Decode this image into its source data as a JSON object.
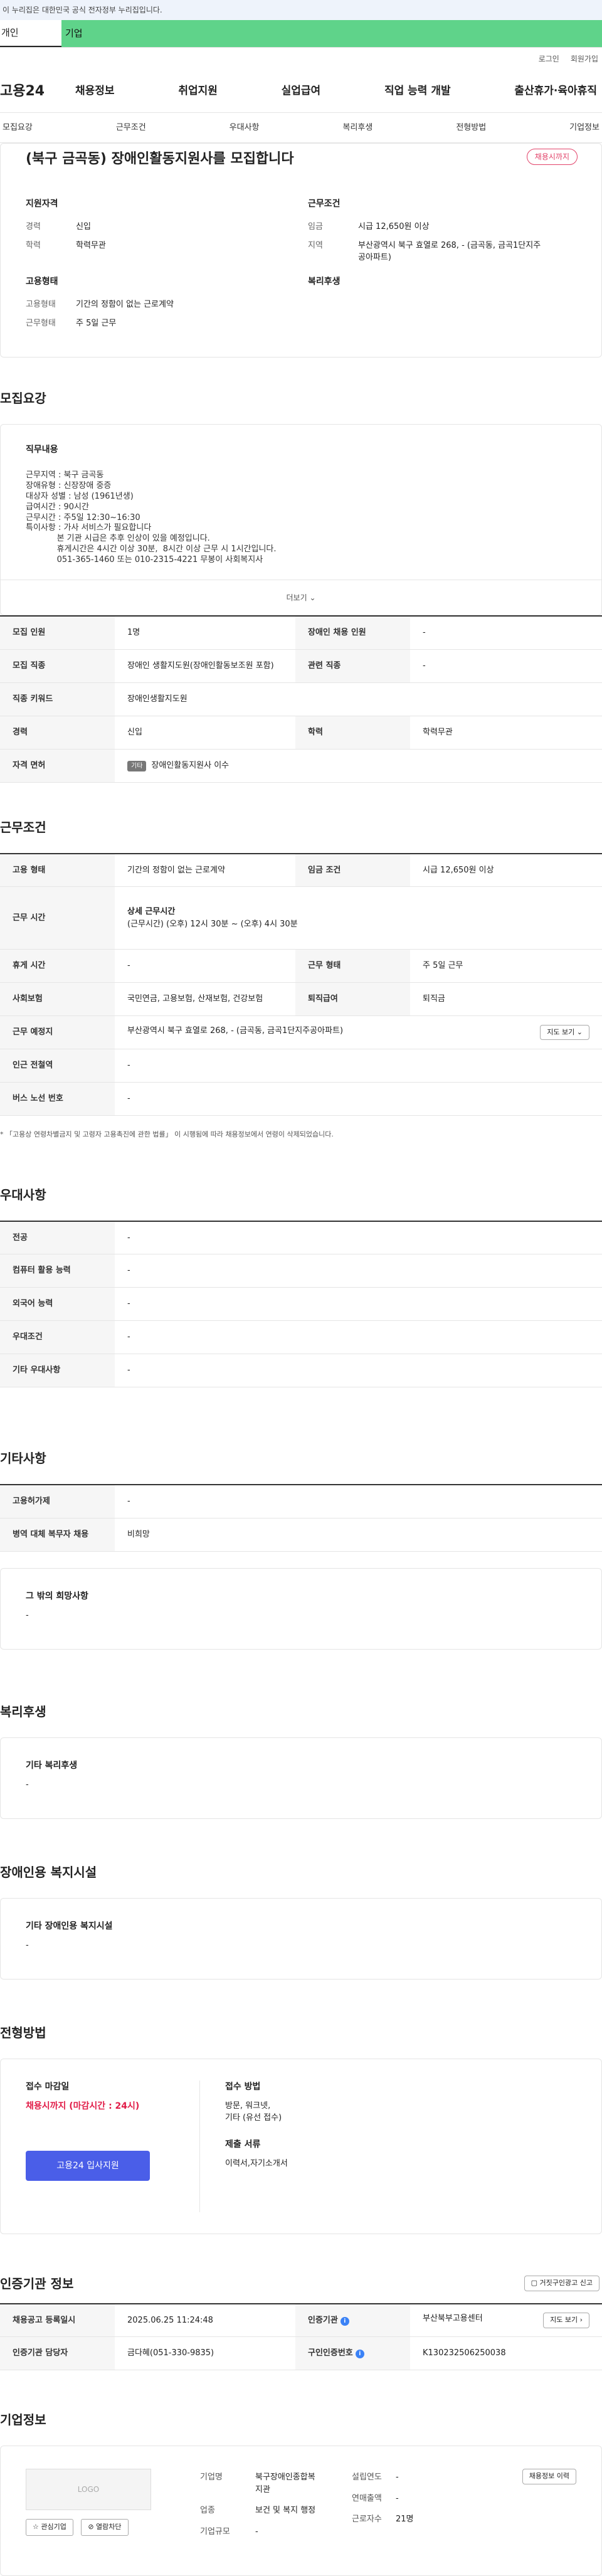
{
  "gov_notice": "이 누리집은 대한민국 공식 전자정부 누리집입니다.",
  "tabs": {
    "personal": "개인",
    "company": "기업"
  },
  "toplinks": [
    "로그인",
    "회원가입"
  ],
  "logo": "고용24",
  "gnb": [
    "채용정보",
    "취업지원",
    "실업급여",
    "직업 능력 개발",
    "출산휴가·육아휴직"
  ],
  "anchors": [
    "모집요강",
    "근무조건",
    "우대사항",
    "복리후생",
    "전형방법",
    "기업정보"
  ],
  "summary": {
    "title": "(북구 금곡동) 장애인활동지원사를 모집합니다",
    "badge": "채용시까지",
    "qual_head": "지원자격",
    "career_k": "경력",
    "career_v": "신입",
    "edu_k": "학력",
    "edu_v": "학력무관",
    "cond_head": "근무조건",
    "wage_k": "임금",
    "wage_v": "시급 12,650원 이상",
    "loc_k": "지역",
    "loc_v": "부산광역시 북구 효열로 268, - (금곡동, 금곡1단지주공아파트)",
    "emp_head": "고용형태",
    "emp_k": "고용형태",
    "emp_v": "기간의 정함이 없는 근로계약",
    "work_k": "근무형태",
    "work_v": "주 5일 근무",
    "welfare_head": "복리후생"
  },
  "recruit": {
    "title": "모집요강",
    "duty_head": "직무내용",
    "lines": [
      "근무지역 : 북구 금곡동",
      "장애유형 : 신장장애 중증",
      "대상자 성별 : 남성 (1961년생)",
      "급여시간 : 90시간",
      "근무시간 : 주5일 12:30~16:30",
      "특이사항 : 가사 서비스가 필요합니다",
      "            본 기관 시급은 추후 인상이 있을 예정입니다.",
      "            휴게시간은 4시간 이상 30분,  8시간 이상 근무 시 1시간입니다.",
      "            051-365-1460 또는 010-2315-4221 무봉이 사회복지사"
    ],
    "more": "더보기",
    "rows": {
      "count_k": "모집 인원",
      "count_v": "1명",
      "dis_k": "장애인 채용 인원",
      "dis_v": "-",
      "job_k": "모집 직종",
      "job_v": "장애인 생활지도원(장애인활동보조원 포함)",
      "rel_k": "관련 직종",
      "rel_v": "-",
      "kw_k": "직종 키워드",
      "kw_v": "장애인생활지도원",
      "car_k": "경력",
      "car_v": "신입",
      "edu_k": "학력",
      "edu_v": "학력무관",
      "lic_k": "자격 면허",
      "lic_chip": "기타",
      "lic_v": "장애인활동지원사 이수"
    }
  },
  "work": {
    "title": "근무조건",
    "type_k": "고용 형태",
    "type_v": "기간의 정함이 없는 근로계약",
    "wage_k": "임금 조건",
    "wage_v": "시급 12,650원 이상",
    "time_k": "근무 시간",
    "time_head": "상세 근무시간",
    "time_v": "(근무시간) (오후) 12시 30분 ~ (오후) 4시 30분",
    "rest_k": "휴게 시간",
    "rest_v": "-",
    "form_k": "근무 형태",
    "form_v": "주 5일 근무",
    "ins_k": "사회보험",
    "ins_v": "국민연금, 고용보험, 산재보험, 건강보험",
    "sev_k": "퇴직급여",
    "sev_v": "퇴직금",
    "place_k": "근무 예정지",
    "place_v": "부산광역시 북구 효열로 268, - (금곡동, 금곡1단지주공아파트)",
    "map_btn": "지도 보기",
    "sub_k": "인근 전철역",
    "sub_v": "-",
    "bus_k": "버스 노선 번호",
    "bus_v": "-",
    "note": "* 「고용상 연령차별금지 및 고령자 고용촉진에 관한 법률」 이 시행됨에 따라 채용정보에서 연령이 삭제되었습니다."
  },
  "pref": {
    "title": "우대사항",
    "rows": [
      [
        "전공",
        "-"
      ],
      [
        "컴퓨터 활용 능력",
        "-"
      ],
      [
        "외국어 능력",
        "-"
      ],
      [
        "우대조건",
        "-"
      ],
      [
        "기타 우대사항",
        "-"
      ]
    ]
  },
  "etc": {
    "title": "기타사항",
    "rows": [
      [
        "고용허가제",
        "-"
      ],
      [
        "병역 대체 복무자 채용",
        "비희망"
      ]
    ],
    "hope_head": "그 밖의 희망사항",
    "hope_v": "-"
  },
  "welfare": {
    "title": "복리후생",
    "head": "기타 복리후생",
    "v": "-"
  },
  "disabled": {
    "title": "장애인용 복지시설",
    "head": "기타 장애인용 복지시설",
    "v": "-"
  },
  "process": {
    "title": "전형방법",
    "deadline_head": "접수 마감일",
    "deadline_v": "채용시까지 (마감시간 : 24시)",
    "apply_btn": "고용24 입사지원",
    "method_head": "접수 방법",
    "method_v1": "방문, 워크넷,",
    "method_v2": "기타 (유선 접수)",
    "docs_head": "제출 서류",
    "docs_v": "이력서,자기소개서"
  },
  "agency": {
    "title": "인증기관 정보",
    "report_btn": "거짓구인광고 신고",
    "reg_k": "채용공고 등록일시",
    "reg_v": "2025.06.25 11:24:48",
    "ag_k": "인증기관",
    "ag_v": "부산북부고용센터",
    "map_btn": "지도 보기",
    "mgr_k": "인증기관 담당자",
    "mgr_v": "금다혜(051-330-9835)",
    "cert_k": "구인인증번호",
    "cert_v": "K130232506250038"
  },
  "company": {
    "title": "기업정보",
    "logo": "LOGO",
    "fav_btn": "관심기업",
    "block_btn": "열람차단",
    "name_k": "기업명",
    "name_v1": "북구장애인종합복",
    "name_v2": "지관",
    "ind_k": "업종",
    "ind_v": "보건 및 복지 행정",
    "size_k": "기업규모",
    "size_v": "-",
    "year_k": "설립연도",
    "year_v": "-",
    "sales_k": "연매출액",
    "sales_v": "-",
    "emp_k": "근로자수",
    "emp_v": "21명",
    "history_btn": "채용정보 이력"
  }
}
